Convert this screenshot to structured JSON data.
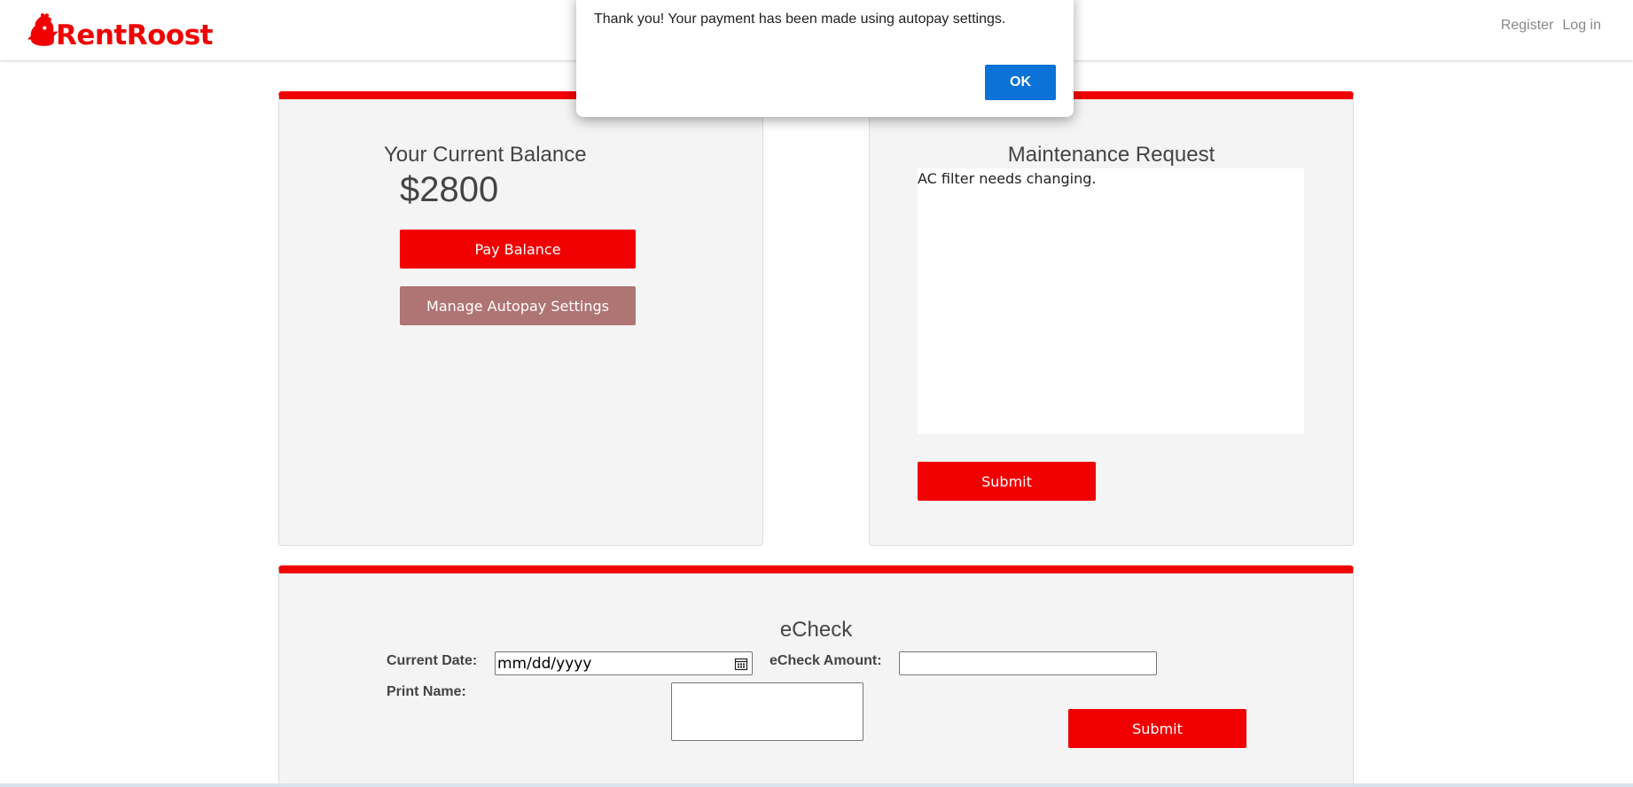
{
  "header": {
    "logo_text": "RentRoost",
    "brand_color": "#f00000",
    "nav": {
      "register": "Register",
      "login": "Log in"
    }
  },
  "balance_panel": {
    "title": "Your Current Balance",
    "amount": "$2800",
    "pay_button": "Pay Balance",
    "autopay_button": "Manage Autopay Settings"
  },
  "maintenance_panel": {
    "title": "Maintenance Request",
    "request_text": "AC filter needs changing.",
    "submit_button": "Submit"
  },
  "echeck_panel": {
    "title": "eCheck",
    "current_date_label": "Current Date:",
    "current_date_value": "mm/dd/yyyy",
    "amount_label": "eCheck Amount:",
    "amount_value": "",
    "print_name_label": "Print Name:",
    "print_name_value": "",
    "submit_button": "Submit"
  },
  "dialog": {
    "message": "Thank you! Your payment has been made using autopay settings.",
    "ok_button": "OK",
    "ok_color": "#0b72d8"
  }
}
